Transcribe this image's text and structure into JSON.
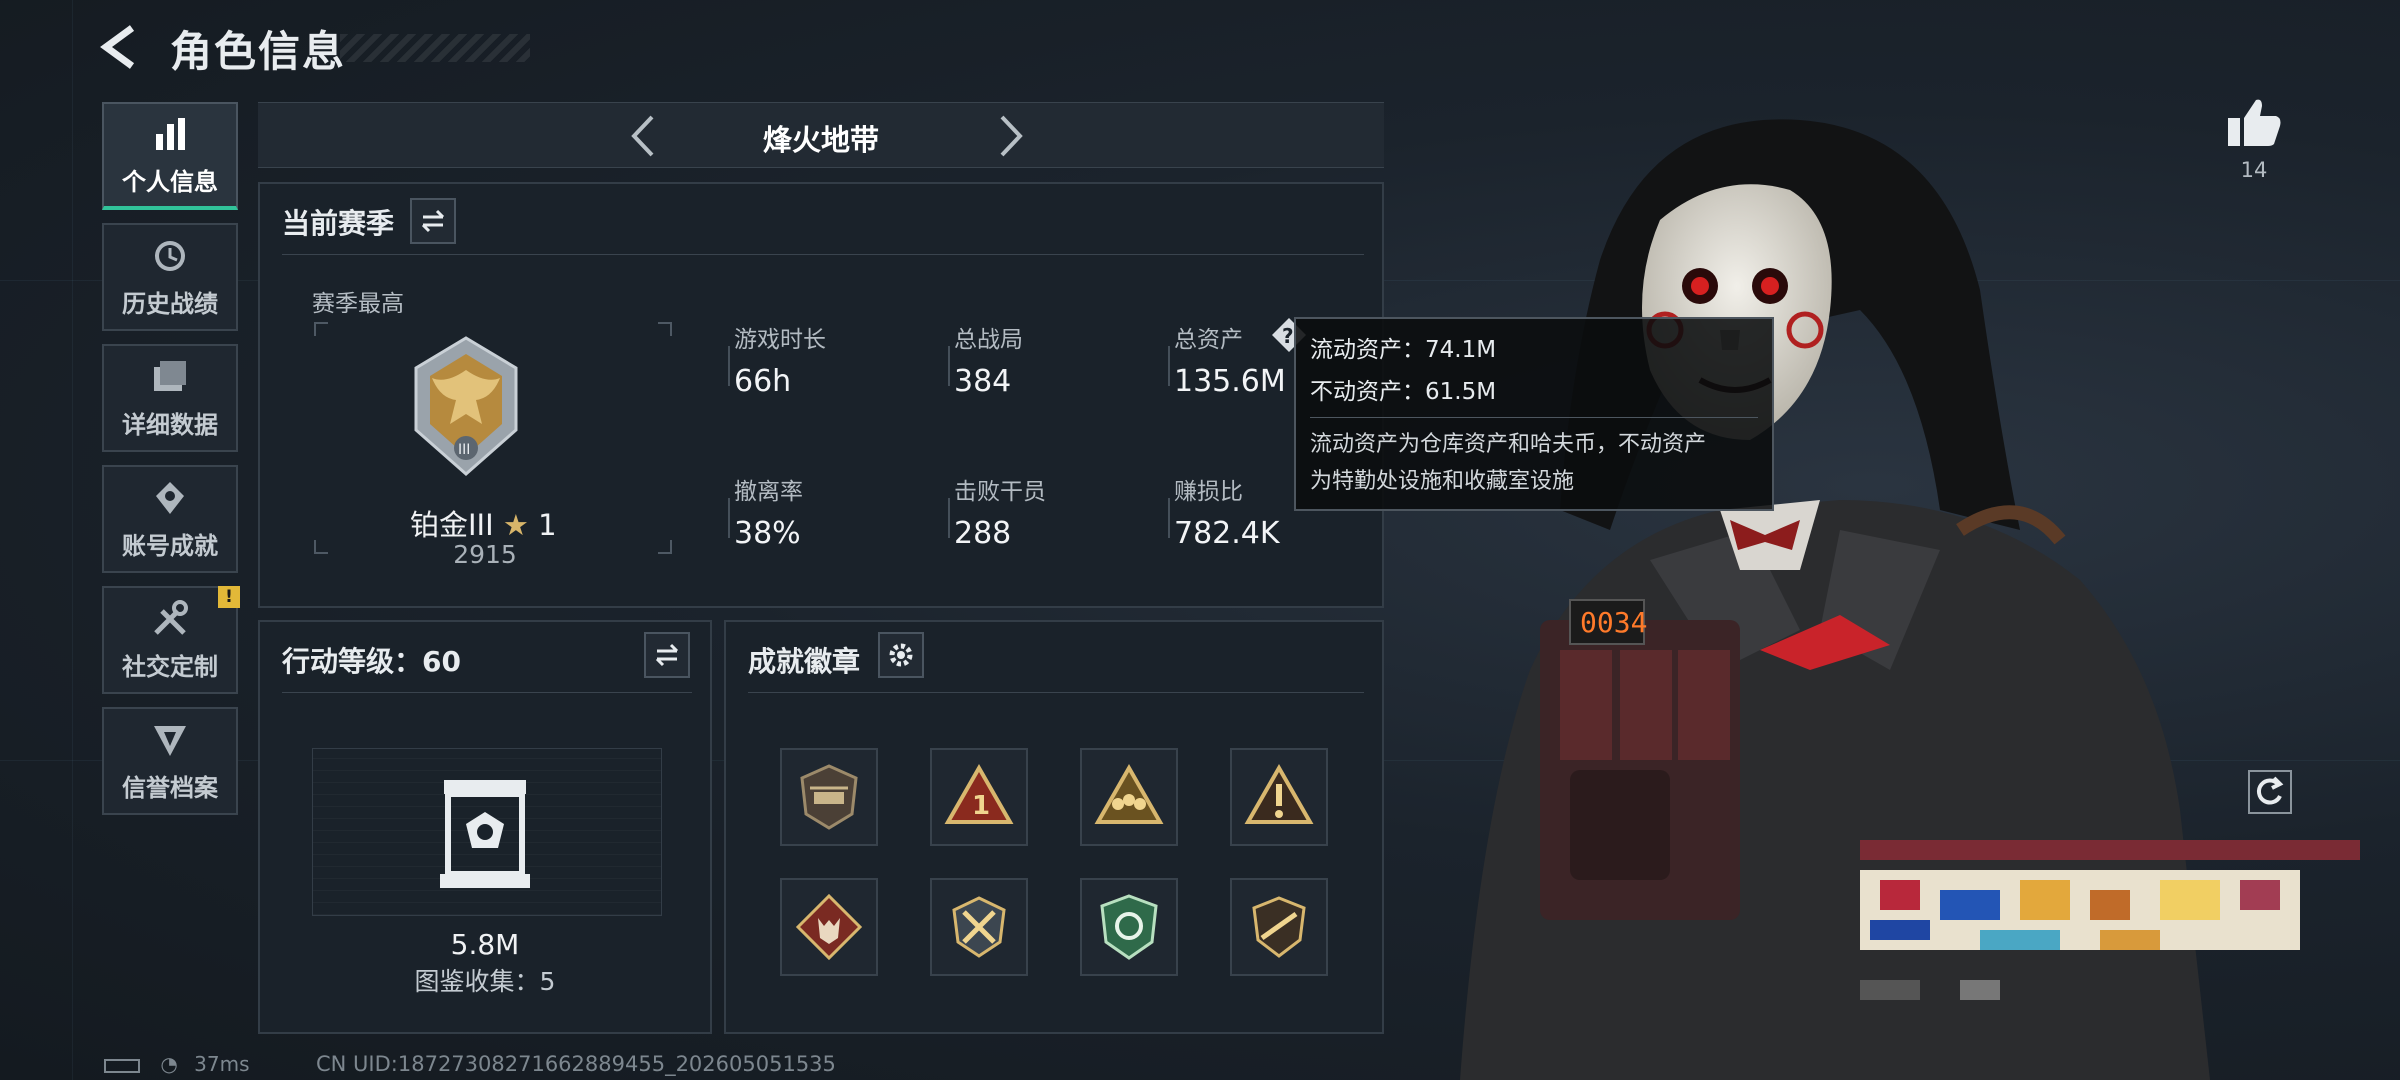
{
  "header": {
    "title": "角色信息"
  },
  "sidebar": {
    "items": [
      {
        "label": "个人信息",
        "icon": "bar-chart-icon",
        "active": true
      },
      {
        "label": "历史战绩",
        "icon": "history-icon"
      },
      {
        "label": "详细数据",
        "icon": "folder-icon"
      },
      {
        "label": "账号成就",
        "icon": "achievement-icon"
      },
      {
        "label": "社交定制",
        "icon": "tools-icon",
        "badge": "!"
      },
      {
        "label": "信誉档案",
        "icon": "credit-icon"
      }
    ]
  },
  "mode": {
    "title": "烽火地带"
  },
  "season": {
    "title": "当前赛季",
    "best_label": "赛季最高",
    "rank_name": "铂金III",
    "rank_stars": "1",
    "rank_score": "2915",
    "stats": [
      {
        "label": "游戏时长",
        "value": "66h"
      },
      {
        "label": "总战局",
        "value": "384"
      },
      {
        "label": "总资产",
        "value": "135.6M"
      },
      {
        "label": "撤离率",
        "value": "38%"
      },
      {
        "label": "击败干员",
        "value": "288"
      },
      {
        "label": "赚损比",
        "value": "782.4K"
      }
    ]
  },
  "tooltip": {
    "liquid": "流动资产：74.1M",
    "fixed": "不动资产：61.5M",
    "desc_line1": "流动资产为仓库资产和哈夫币，不动资产",
    "desc_line2": "为特勤处设施和收藏室设施"
  },
  "level": {
    "title": "行动等级：60",
    "value": "5.8M",
    "collection": "图鉴收集：5"
  },
  "badges": {
    "title": "成就徽章"
  },
  "like": {
    "count": "14"
  },
  "status": {
    "ping": "37ms",
    "uid": "CN UID:18727308271662889455_202605051535"
  },
  "colors": {
    "accent": "#31c39a",
    "warning": "#e2b838",
    "gold": "#c9a050"
  }
}
